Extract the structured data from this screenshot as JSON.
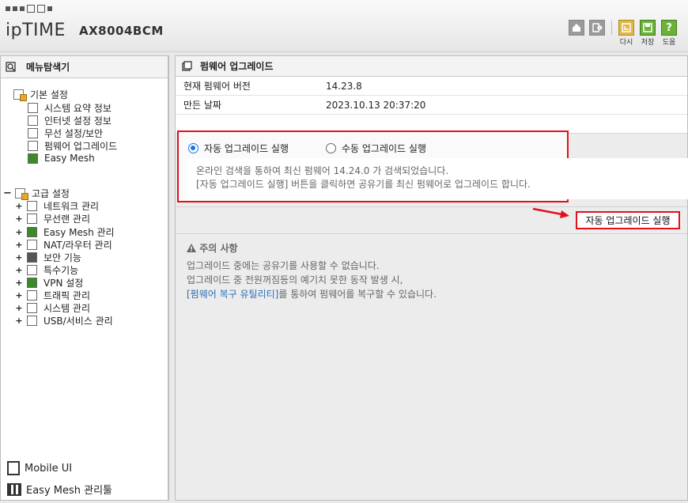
{
  "header": {
    "brand": "ipTIME",
    "model": "AX8004BCM",
    "buttons": [
      {
        "label": "다시",
        "icon": "undo-icon"
      },
      {
        "label": "저장",
        "icon": "save-icon"
      },
      {
        "label": "도움",
        "icon": "help-icon"
      }
    ]
  },
  "left": {
    "title": "메뉴탐색기",
    "basic": {
      "label": "기본 설정",
      "items": [
        "시스템 요약 정보",
        "인터넷 설정 정보",
        "무선 설정/보안",
        "펌웨어 업그레이드",
        "Easy Mesh"
      ]
    },
    "advanced": {
      "label": "고급 설정",
      "items": [
        "네트워크 관리",
        "무선랜 관리",
        "Easy Mesh 관리",
        "NAT/라우터 관리",
        "보안 기능",
        "특수기능",
        "VPN 설정",
        "트래픽 관리",
        "시스템 관리",
        "USB/서비스 관리"
      ]
    },
    "bottom_links": [
      "Mobile UI",
      "Easy Mesh 관리툴"
    ]
  },
  "right": {
    "title": "펌웨어 업그레이드",
    "info": [
      {
        "key": "현재 펌웨어 버전",
        "value": "14.23.8"
      },
      {
        "key": "만든 날짜",
        "value": "2023.10.13 20:37:20"
      }
    ],
    "radio_auto": "자동 업그레이드 실행",
    "radio_manual": "수동 업그레이드 실행",
    "message_line1": "온라인 검색을 통하여 최신 펌웨어 14.24.0 가 검색되었습니다.",
    "message_line2": "[자동 업그레이드 실행] 버튼을 클릭하면 공유기를 최신 펌웨어로 업그레이드 합니다.",
    "run_button": "자동 업그레이드 실행",
    "notice_title": "주의 사항",
    "notice_line1": "업그레이드 중에는 공유기를 사용할 수 없습니다.",
    "notice_line2": "업그레이드 중 전원꺼짐등의 예기치 못한 동작 발생 시,",
    "notice_link": "[펌웨어 복구 유틸리티]",
    "notice_line3_rest": "를 통하여 펌웨어를 복구할 수 있습니다."
  },
  "colors": {
    "highlight": "#e3101a",
    "link": "#2a6fb8",
    "radio": "#1a73e8"
  }
}
